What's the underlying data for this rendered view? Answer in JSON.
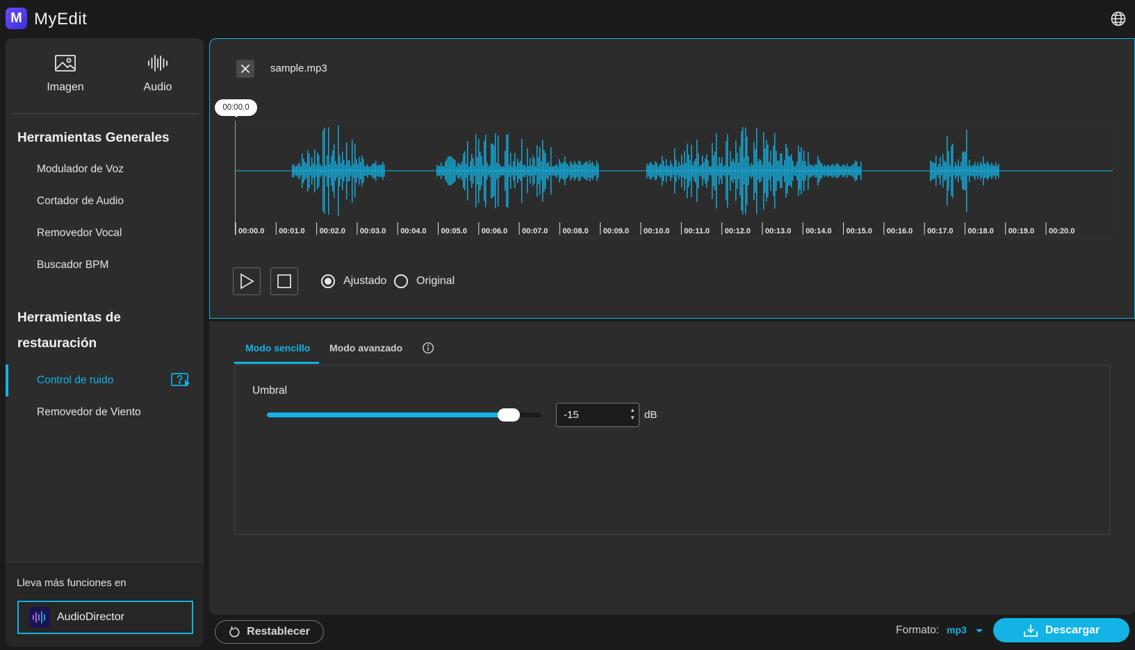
{
  "app": {
    "name": "MyEdit",
    "logo_letter": "M"
  },
  "categories": [
    {
      "label": "Imagen",
      "icon": "image-icon"
    },
    {
      "label": "Audio",
      "icon": "audio-waveform-icon"
    }
  ],
  "sidebar": {
    "general_title": "Herramientas Generales",
    "general_items": [
      "Modulador de Voz",
      "Cortador de Audio",
      "Removedor Vocal",
      "Buscador BPM"
    ],
    "restoration_title_line1": "Herramientas de",
    "restoration_title_line2": "restauración",
    "restoration_items": [
      {
        "label": "Control de ruido",
        "active": true
      },
      {
        "label": "Removedor de Viento",
        "active": false
      }
    ],
    "promo_text": "Lleva más funciones en",
    "promo_button": "AudioDirector"
  },
  "player": {
    "file_name": "sample.mp3",
    "playhead_time": "00:00.0",
    "ticks": [
      "00:00.0",
      "00:01.0",
      "00:02.0",
      "00:03.0",
      "00:04.0",
      "00:05.0",
      "00:06.0",
      "00:07.0",
      "00:08.0",
      "00:09.0",
      "00:10.0",
      "00:11.0",
      "00:12.0",
      "00:13.0",
      "00:14.0",
      "00:15.0",
      "00:16.0",
      "00:17.0",
      "00:18.0",
      "00:19.0",
      "00:20.0"
    ],
    "view_options": [
      {
        "label": "Ajustado",
        "selected": true
      },
      {
        "label": "Original",
        "selected": false
      }
    ]
  },
  "settings": {
    "tabs": [
      {
        "label": "Modo sencillo",
        "active": true
      },
      {
        "label": "Modo avanzado",
        "active": false
      }
    ],
    "threshold_label": "Umbral",
    "threshold_value": "-15",
    "threshold_unit": "dB",
    "slider_fraction": 0.88
  },
  "footer": {
    "reset_label": "Restablecer",
    "format_label": "Formato:",
    "format_value": "mp3",
    "download_label": "Descargar"
  },
  "colors": {
    "accent": "#13b3e5",
    "panel": "#2c2c2c",
    "background": "#1b1b1b"
  }
}
